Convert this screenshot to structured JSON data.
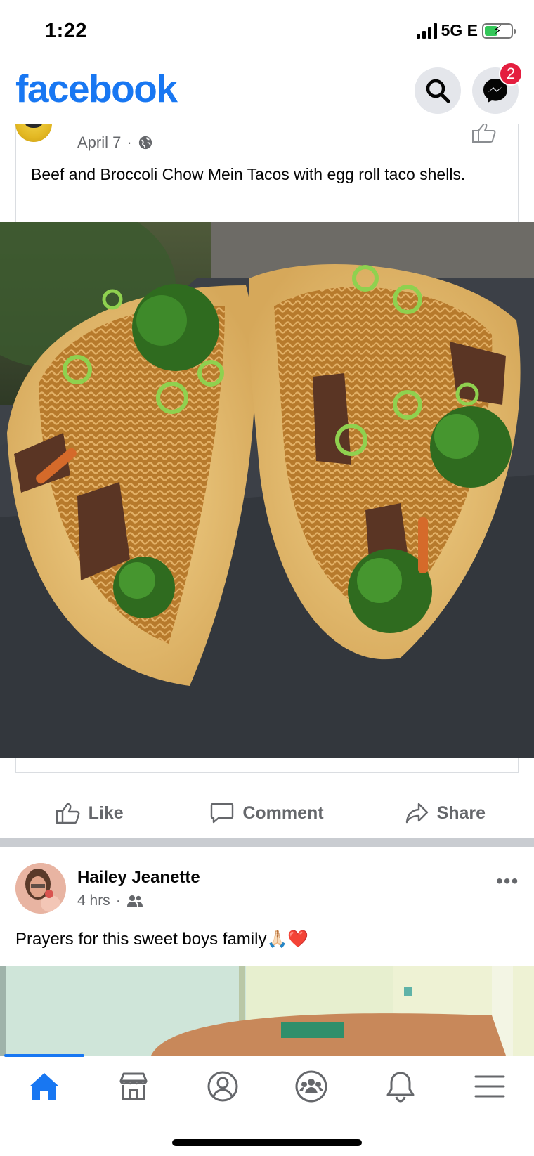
{
  "status_bar": {
    "time": "1:22",
    "network": "5G E",
    "battery_level": 0.45
  },
  "header": {
    "brand": "facebook",
    "brand_color": "#1877f2",
    "search_icon": "search-icon",
    "messenger_icon": "messenger-icon",
    "messenger_badge": "2"
  },
  "post1": {
    "date": "April 7",
    "separator": "·",
    "privacy_icon": "globe-icon",
    "text": "Beef and Broccoli Chow Mein Tacos with egg roll taco shells.",
    "photo_icon": "tacos-photo"
  },
  "actions": {
    "like": "Like",
    "comment": "Comment",
    "share": "Share"
  },
  "post2": {
    "author": "Hailey Jeanette",
    "time": "4 hrs",
    "separator": "·",
    "privacy_icon": "friends-icon",
    "text": "Prayers for this sweet boys family🙏🏻❤️",
    "more_icon": "more-options-icon"
  },
  "bottom_nav": {
    "items": [
      "home-icon",
      "marketplace-icon",
      "profile-icon",
      "groups-icon",
      "notifications-icon",
      "menu-icon"
    ],
    "active": "home-icon"
  }
}
